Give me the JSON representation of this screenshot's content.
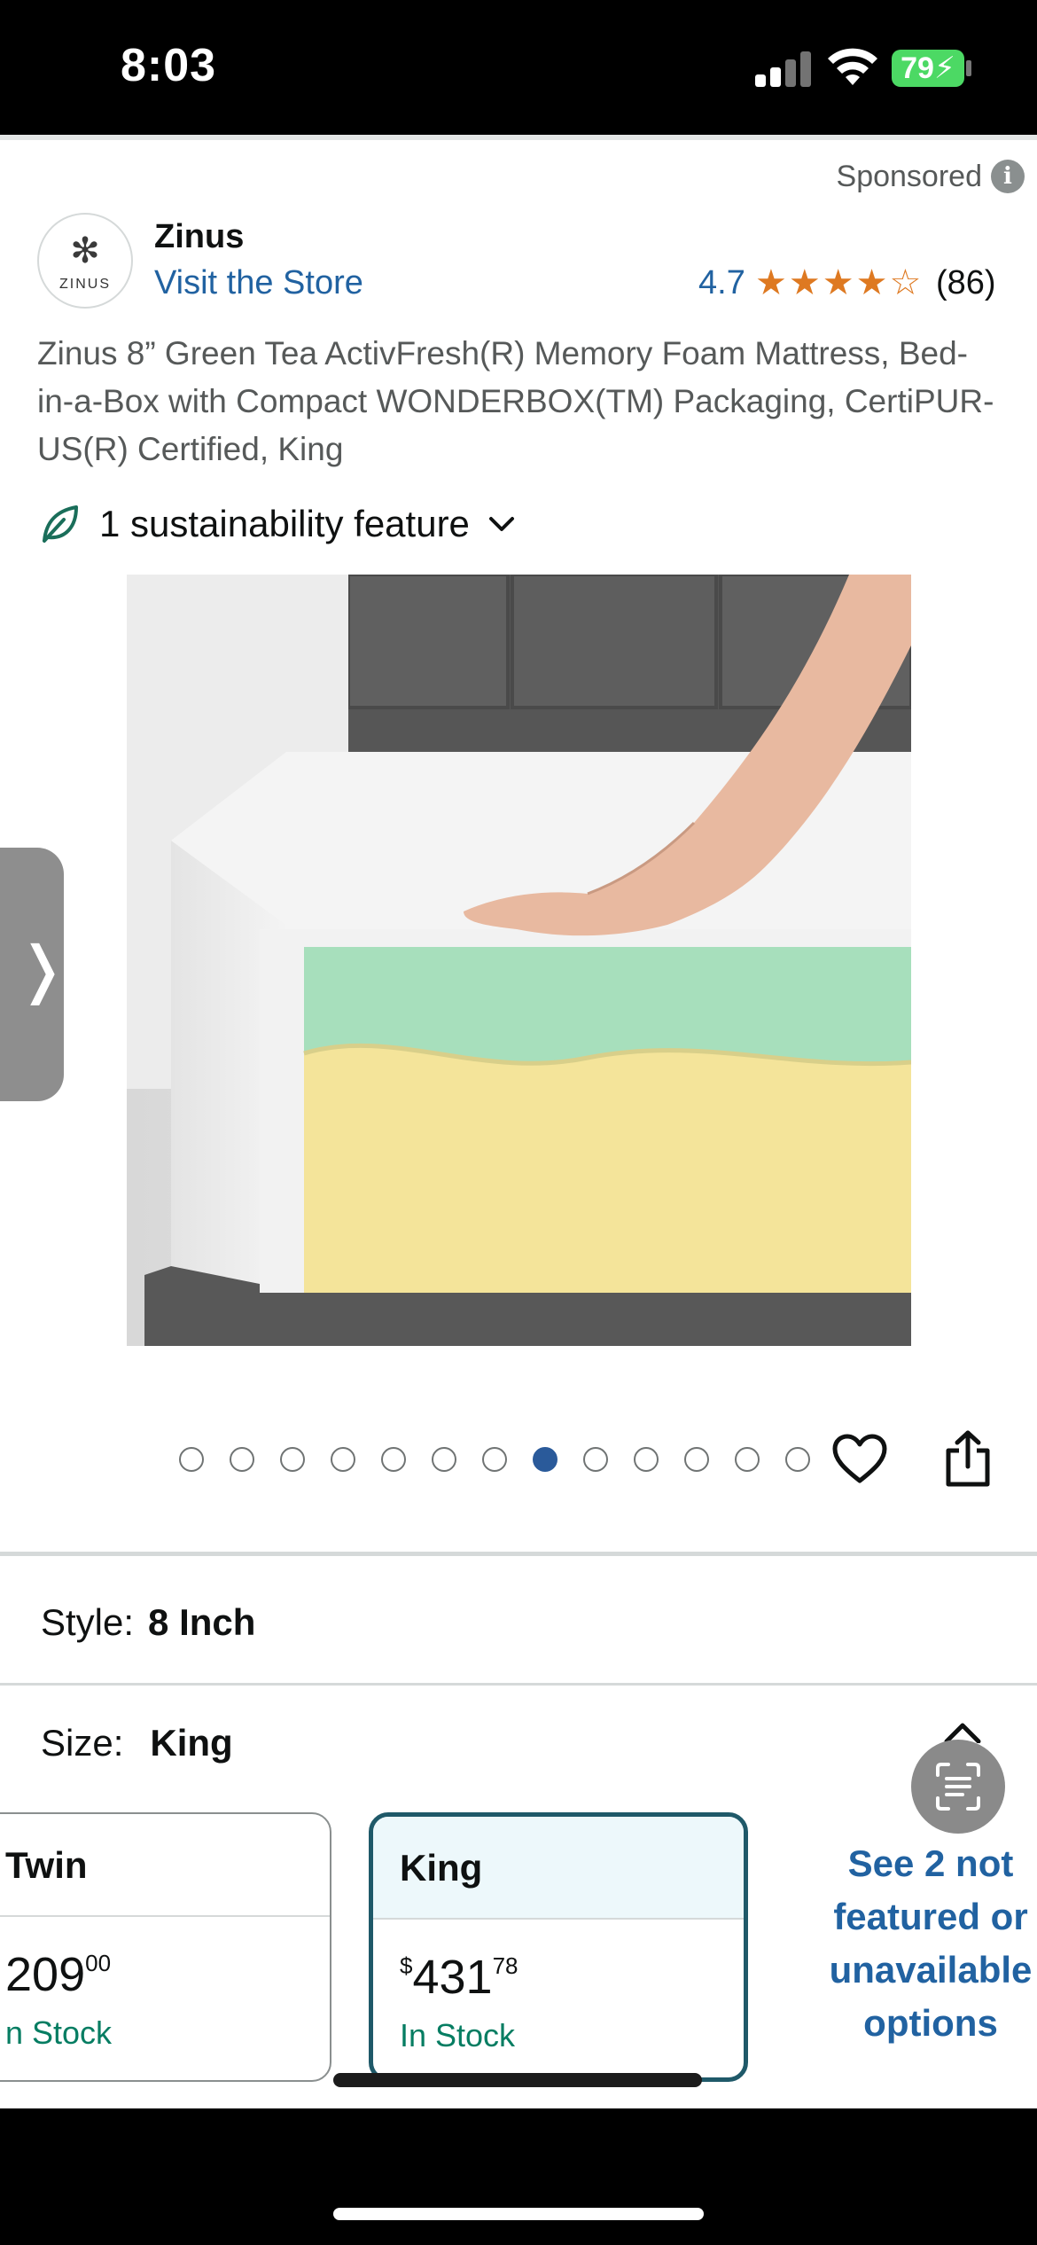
{
  "status_bar": {
    "time": "8:03",
    "battery": "79"
  },
  "ad": {
    "sponsored_label": "Sponsored",
    "info_icon": "i"
  },
  "brand": {
    "logo_text": "ZINUS",
    "name": "Zinus",
    "visit_store": "Visit the Store"
  },
  "rating": {
    "value": "4.7",
    "stars": "★★★★☆",
    "count": "(86)",
    "star_color": "#de7921"
  },
  "product": {
    "title": "Zinus 8” Green Tea ActivFresh(R) Memory Foam Mattress, Bed-in-a-Box with Compact WONDERBOX(TM) Packaging, CertiPUR-US(R) Certified, King",
    "sustainability": "1 sustainability feature"
  },
  "carousel": {
    "total_images": 13,
    "active_index": 7,
    "active_color": "#2a5a9a"
  },
  "variations": {
    "style_label": "Style:",
    "style_value": "8 Inch",
    "size_label": "Size:",
    "size_value": "King"
  },
  "size_options": [
    {
      "name": "Twin",
      "price_whole": "209",
      "price_fraction": "00",
      "currency": "",
      "stock": "n Stock"
    },
    {
      "name": "King",
      "price_whole": "431",
      "price_fraction": "78",
      "currency": "$",
      "stock": "In Stock"
    }
  ],
  "see_more": "See 2 not featured or unavailable options",
  "colors": {
    "link": "#2162a1",
    "in_stock": "#067d62",
    "selected_border": "#1f5969"
  }
}
